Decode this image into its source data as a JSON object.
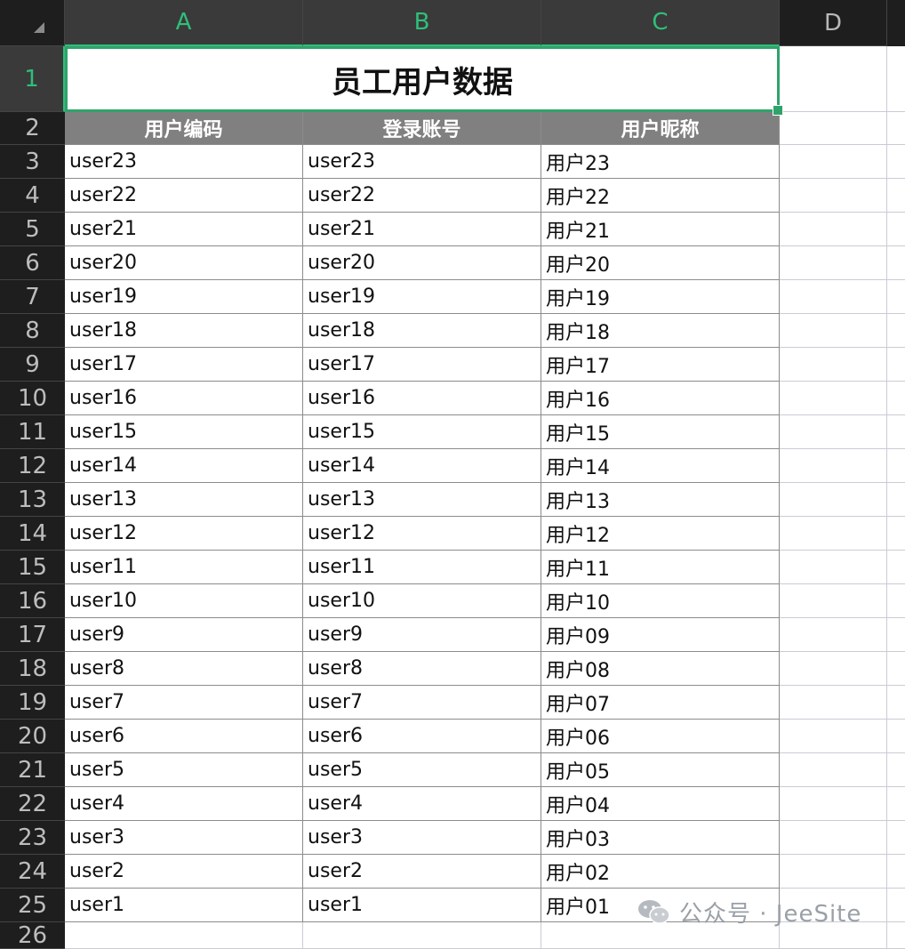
{
  "columns": [
    "A",
    "B",
    "C",
    "D"
  ],
  "row_numbers": [
    "1",
    "2",
    "3",
    "4",
    "5",
    "6",
    "7",
    "8",
    "9",
    "10",
    "11",
    "12",
    "13",
    "14",
    "15",
    "16",
    "17",
    "18",
    "19",
    "20",
    "21",
    "22",
    "23",
    "24",
    "25",
    "26"
  ],
  "title": "员工用户数据",
  "headers": [
    "用户编码",
    "登录账号",
    "用户昵称"
  ],
  "rows": [
    [
      "user23",
      "user23",
      "用户23"
    ],
    [
      "user22",
      "user22",
      "用户22"
    ],
    [
      "user21",
      "user21",
      "用户21"
    ],
    [
      "user20",
      "user20",
      "用户20"
    ],
    [
      "user19",
      "user19",
      "用户19"
    ],
    [
      "user18",
      "user18",
      "用户18"
    ],
    [
      "user17",
      "user17",
      "用户17"
    ],
    [
      "user16",
      "user16",
      "用户16"
    ],
    [
      "user15",
      "user15",
      "用户15"
    ],
    [
      "user14",
      "user14",
      "用户14"
    ],
    [
      "user13",
      "user13",
      "用户13"
    ],
    [
      "user12",
      "user12",
      "用户12"
    ],
    [
      "user11",
      "user11",
      "用户11"
    ],
    [
      "user10",
      "user10",
      "用户10"
    ],
    [
      "user9",
      "user9",
      "用户09"
    ],
    [
      "user8",
      "user8",
      "用户08"
    ],
    [
      "user7",
      "user7",
      "用户07"
    ],
    [
      "user6",
      "user6",
      "用户06"
    ],
    [
      "user5",
      "user5",
      "用户05"
    ],
    [
      "user4",
      "user4",
      "用户04"
    ],
    [
      "user3",
      "user3",
      "用户03"
    ],
    [
      "user2",
      "user2",
      "用户02"
    ],
    [
      "user1",
      "user1",
      "用户01"
    ]
  ],
  "watermark": "公众号 · JeeSite",
  "colors": {
    "selection": "#2fa36b",
    "header_fill": "#808080",
    "chrome": "#1e1e1e"
  }
}
